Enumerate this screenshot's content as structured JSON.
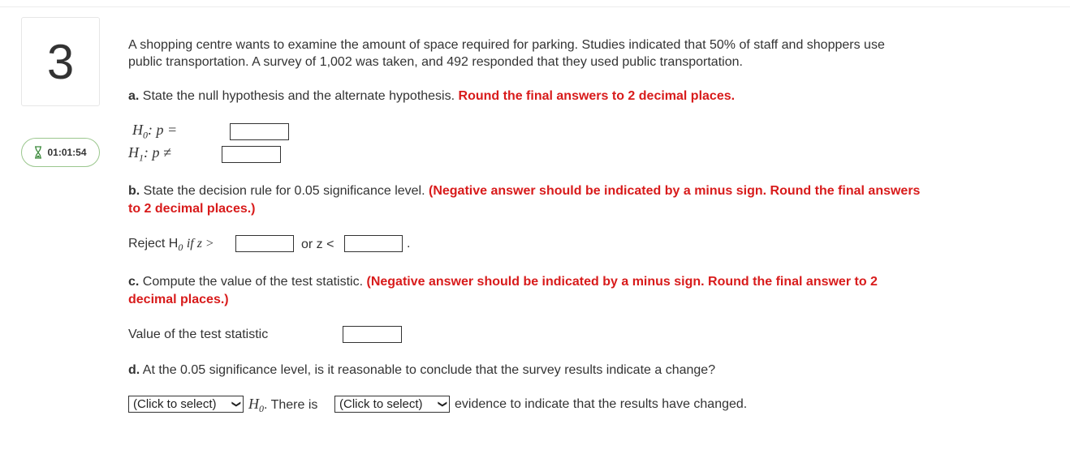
{
  "question": {
    "number": "3",
    "timer": "01:01:54",
    "intro_line1": "A shopping centre wants to examine the amount of space required for parking. Studies indicated that 50% of staff and shoppers use",
    "intro_line2": "public transportation. A survey of 1,002 was taken, and 492 responded that they used public transportation."
  },
  "part_a": {
    "label": "a.",
    "text": "State the null hypothesis and the alternate hypothesis.",
    "instruction": "Round the final answers to 2 decimal places.",
    "h0_label": "H",
    "h0_sub": "0",
    "h0_rest": ": p =",
    "h1_label": "H",
    "h1_sub": "1",
    "h1_rest": ": p ≠"
  },
  "part_b": {
    "label": "b.",
    "text": "State the decision rule for 0.05 significance level.",
    "instruction_line1": "(Negative answer should be indicated by a minus sign. Round the final answers",
    "instruction_line2": "to 2 decimal places.)",
    "reject_prefix": "Reject H",
    "reject_sub": "0",
    "reject_if": "if z >",
    "or_text": "or z <",
    "end_period": "."
  },
  "part_c": {
    "label": "c.",
    "text": "Compute the value of the test statistic.",
    "instruction_line1": "(Negative answer should be indicated by a minus sign. Round the final answer to 2",
    "instruction_line2": "decimal places.)",
    "value_label": "Value of the test statistic"
  },
  "part_d": {
    "label": "d.",
    "text": "At the 0.05 significance level, is it reasonable to conclude that the survey results indicate a change?",
    "select1": "(Click to select)",
    "h_label": "H",
    "h_sub": "0",
    "middle_text": ". There is",
    "select2": "(Click to select)",
    "end_text": "evidence to indicate that the results have changed."
  },
  "colors": {
    "instruction_red": "#d81b1b",
    "timer_border": "#9bc78e",
    "hourglass_green": "#3c8a3c"
  }
}
